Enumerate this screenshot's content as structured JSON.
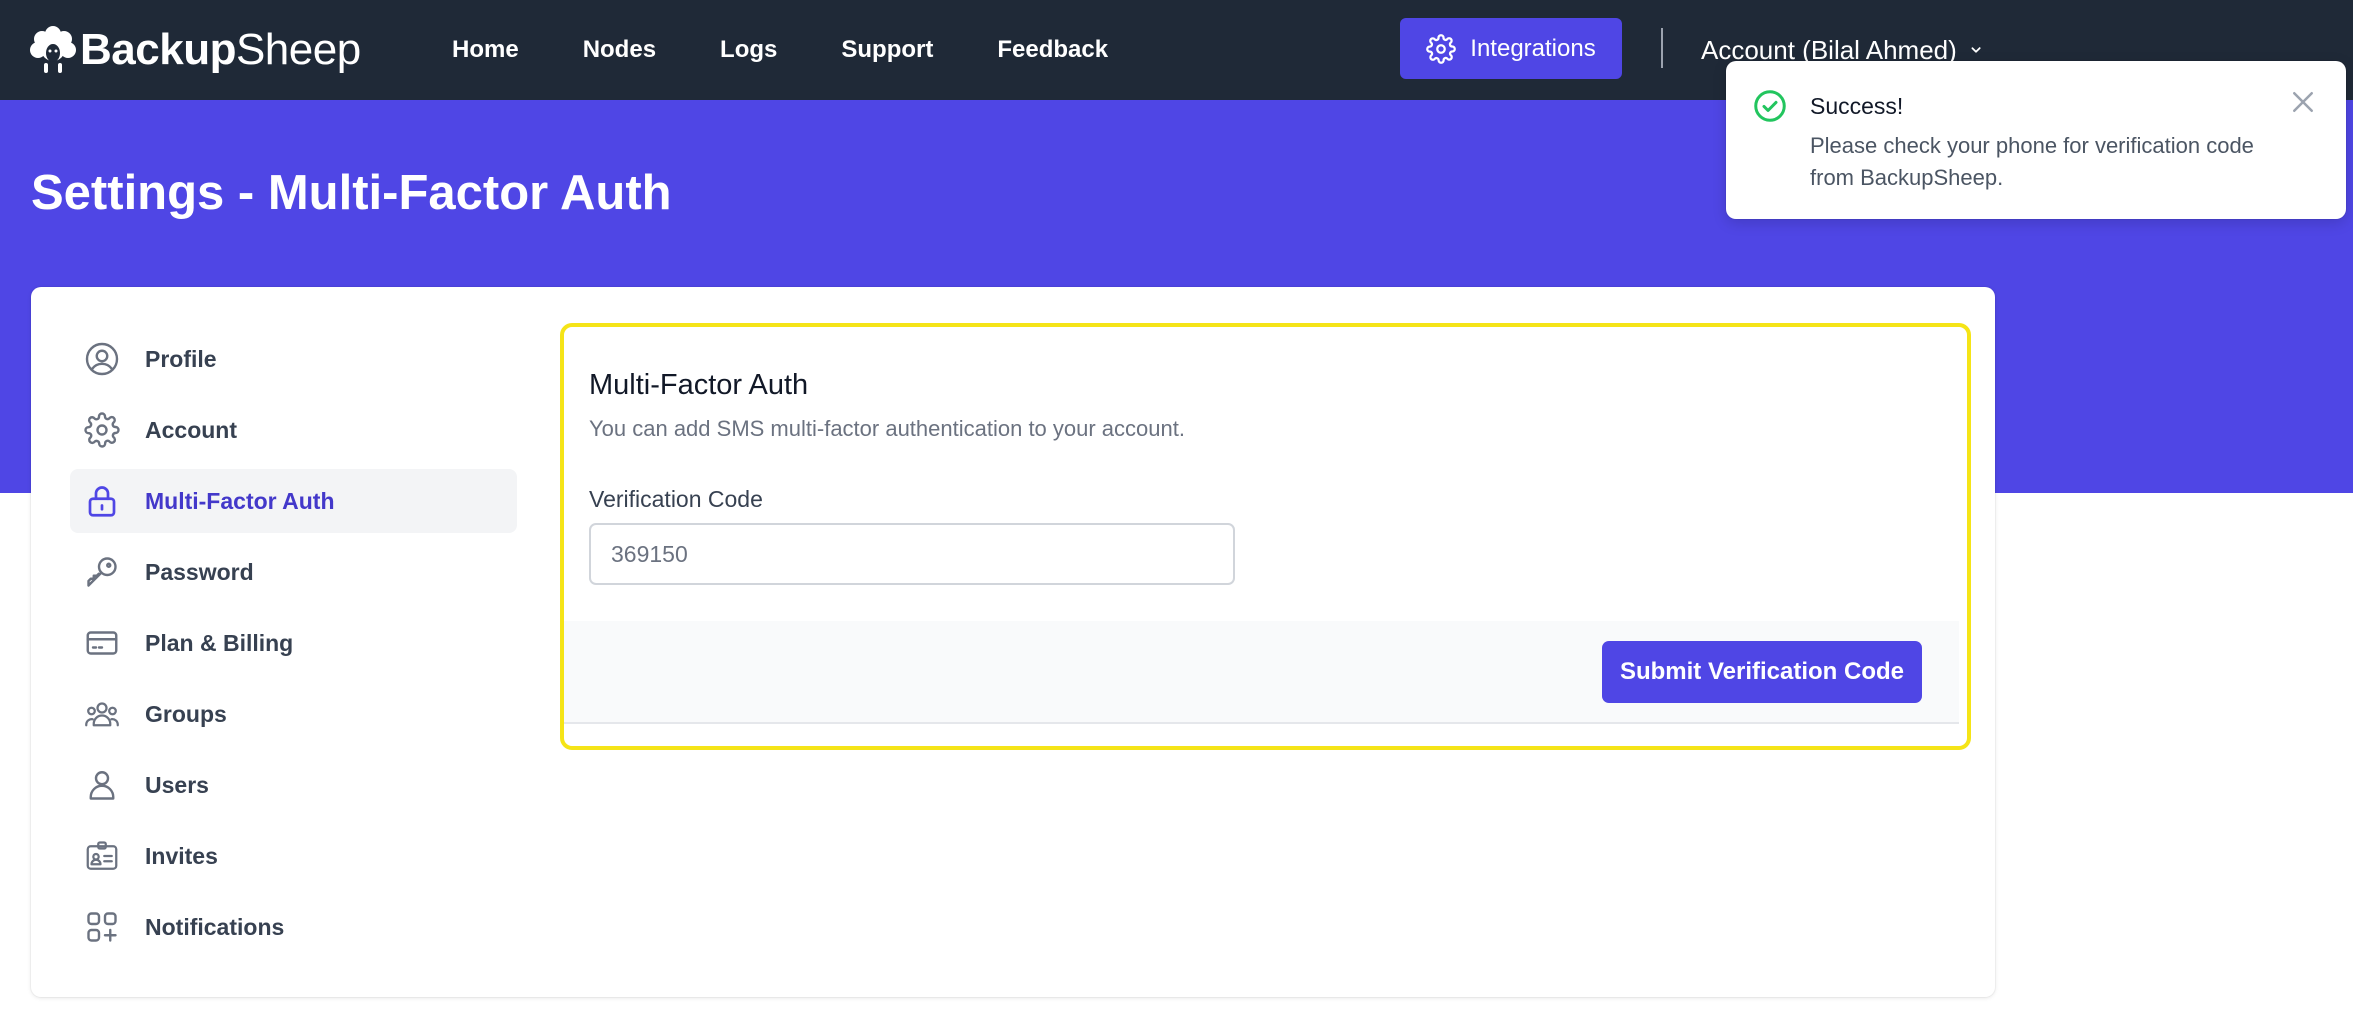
{
  "brand": {
    "part1": "Backup",
    "part2": "Sheep",
    "logo_icon": "sheep-icon"
  },
  "nav": {
    "items": [
      {
        "label": "Home"
      },
      {
        "label": "Nodes"
      },
      {
        "label": "Logs"
      },
      {
        "label": "Support"
      },
      {
        "label": "Feedback"
      }
    ],
    "integrations_label": "Integrations",
    "account_label": "Account (Bilal Ahmed)"
  },
  "page": {
    "title": "Settings - Multi-Factor Auth"
  },
  "sidebar": {
    "items": [
      {
        "label": "Profile",
        "icon": "user-circle-icon"
      },
      {
        "label": "Account",
        "icon": "gear-icon"
      },
      {
        "label": "Multi-Factor Auth",
        "icon": "lock-icon",
        "active": true
      },
      {
        "label": "Password",
        "icon": "key-icon"
      },
      {
        "label": "Plan & Billing",
        "icon": "credit-card-icon"
      },
      {
        "label": "Groups",
        "icon": "user-group-icon"
      },
      {
        "label": "Users",
        "icon": "user-icon"
      },
      {
        "label": "Invites",
        "icon": "id-card-icon"
      },
      {
        "label": "Notifications",
        "icon": "apps-add-icon"
      }
    ]
  },
  "mfa": {
    "title": "Multi-Factor Auth",
    "description": "You can add SMS multi-factor authentication to your account.",
    "field_label": "Verification Code",
    "code_value": "369150",
    "submit_label": "Submit Verification Code"
  },
  "toast": {
    "title": "Success!",
    "message": "Please check your phone for verification code from BackupSheep."
  },
  "colors": {
    "topbar": "#1f2937",
    "accent": "#4f46e5",
    "highlight_border": "#f5e417",
    "success": "#22c55e"
  }
}
